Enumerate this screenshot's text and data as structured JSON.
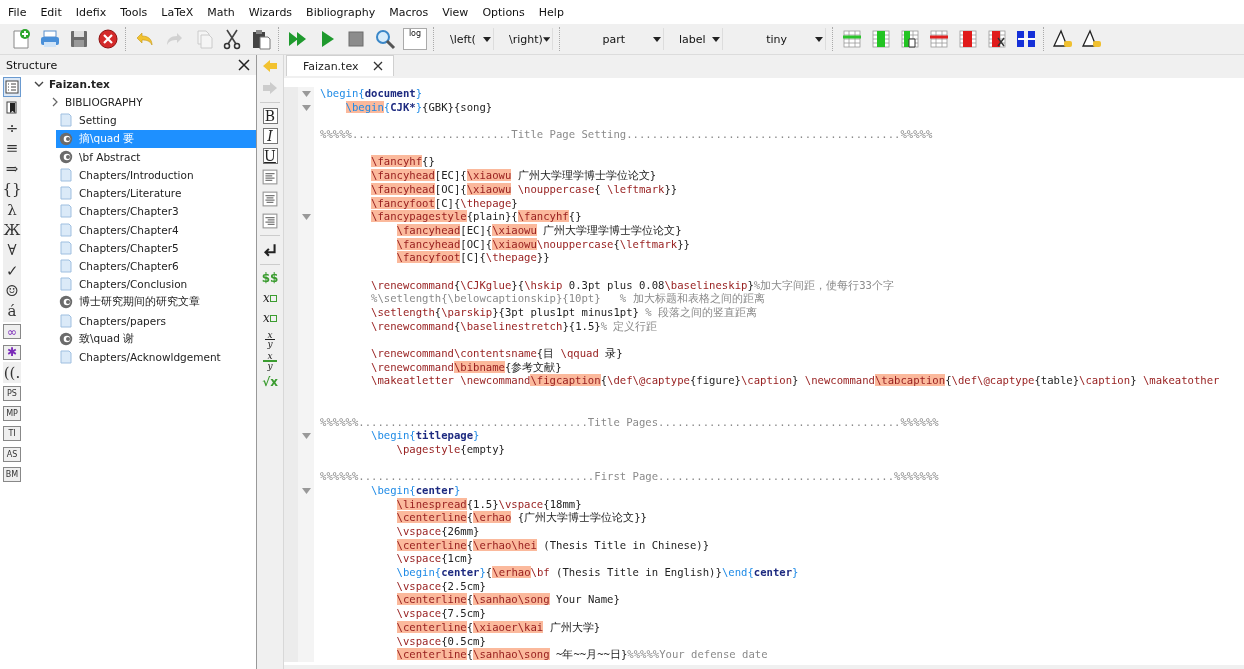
{
  "menu": [
    "File",
    "Edit",
    "Idefix",
    "Tools",
    "LaTeX",
    "Math",
    "Wizards",
    "Bibliography",
    "Macros",
    "View",
    "Options",
    "Help"
  ],
  "toolbar": [
    [
      {
        "kind": "new"
      },
      {
        "kind": "print"
      },
      {
        "kind": "save"
      },
      {
        "kind": "close"
      }
    ],
    [
      {
        "kind": "undo",
        "disabled": false
      },
      {
        "kind": "redo",
        "disabled": true
      },
      {
        "kind": "copy",
        "disabled": true
      },
      {
        "kind": "cut",
        "disabled": false
      },
      {
        "kind": "paste",
        "disabled": false
      }
    ],
    [
      {
        "kind": "build"
      },
      {
        "kind": "run"
      },
      {
        "kind": "stop"
      },
      {
        "kind": "view"
      },
      {
        "kind": "log",
        "text": "log"
      }
    ],
    [
      {
        "kind": "dropdown",
        "value": "\\left("
      },
      {
        "kind": "dropdown",
        "value": "\\right)"
      }
    ],
    [
      {
        "kind": "dropdown-wide",
        "value": "part"
      },
      {
        "kind": "dropdown",
        "value": "label"
      },
      {
        "kind": "dropdown-wide",
        "value": "tiny"
      }
    ],
    [
      {
        "kind": "t-row-add"
      },
      {
        "kind": "t-col-add"
      },
      {
        "kind": "t-col-page"
      },
      {
        "kind": "t-row-del"
      },
      {
        "kind": "t-col-del"
      },
      {
        "kind": "t-col-cut"
      },
      {
        "kind": "t-cols"
      }
    ],
    [
      {
        "kind": "triangle"
      },
      {
        "kind": "triangle"
      }
    ]
  ],
  "structure": {
    "title": "Structure",
    "tabs": [
      {
        "kind": "list",
        "selected": true
      },
      {
        "kind": "bookmark",
        "selected": false
      },
      {
        "kind": "glyph",
        "text": "÷",
        "selected": false
      },
      {
        "kind": "glyph",
        "text": "≡",
        "selected": false
      },
      {
        "kind": "glyph",
        "text": "⇒",
        "selected": false
      },
      {
        "kind": "glyph",
        "text": "{}",
        "selected": false
      },
      {
        "kind": "glyph",
        "text": "λ",
        "selected": false
      },
      {
        "kind": "glyph",
        "text": "Ж",
        "selected": false
      },
      {
        "kind": "glyph",
        "text": "∀",
        "selected": false
      },
      {
        "kind": "glyph",
        "text": "✓",
        "selected": false
      },
      {
        "kind": "glyph",
        "text": "☺",
        "selected": false
      },
      {
        "kind": "glyph",
        "text": "á",
        "selected": false
      },
      {
        "kind": "boxed",
        "text": "∞",
        "selected": false
      },
      {
        "kind": "boxed",
        "text": "✱",
        "selected": false
      },
      {
        "kind": "glyph",
        "text": "((.",
        "selected": false
      },
      {
        "kind": "boxed",
        "text": "PS",
        "selected": false
      },
      {
        "kind": "boxed",
        "text": "MP",
        "selected": false
      },
      {
        "kind": "boxed",
        "text": "TI",
        "selected": false
      },
      {
        "kind": "boxed",
        "text": "AS",
        "selected": false
      },
      {
        "kind": "boxed",
        "text": "BM",
        "selected": false
      }
    ],
    "tree": {
      "label": "Faizan.tex",
      "expanded": true,
      "children": [
        {
          "kind": "group",
          "label": "BIBLIOGRAPHY",
          "expanded": false,
          "selected": false
        },
        {
          "kind": "file",
          "label": "Setting",
          "selected": false
        },
        {
          "kind": "section",
          "label": "摘\\quad 要",
          "selected": true
        },
        {
          "kind": "section",
          "label": "\\bf Abstract",
          "selected": false
        },
        {
          "kind": "file",
          "label": "Chapters/Introduction",
          "selected": false
        },
        {
          "kind": "file",
          "label": "Chapters/Literature",
          "selected": false
        },
        {
          "kind": "file",
          "label": "Chapters/Chapter3",
          "selected": false
        },
        {
          "kind": "file",
          "label": "Chapters/Chapter4",
          "selected": false
        },
        {
          "kind": "file",
          "label": "Chapters/Chapter5",
          "selected": false
        },
        {
          "kind": "file",
          "label": "Chapters/Chapter6",
          "selected": false
        },
        {
          "kind": "file",
          "label": "Chapters/Conclusion",
          "selected": false
        },
        {
          "kind": "section",
          "label": "博士研究期间的研究文章",
          "selected": false
        },
        {
          "kind": "file",
          "label": "Chapters/papers",
          "selected": false
        },
        {
          "kind": "section",
          "label": "致\\quad 谢",
          "selected": false
        },
        {
          "kind": "file",
          "label": "Chapters/Acknowldgement",
          "selected": false
        }
      ]
    }
  },
  "navigation": [
    {
      "kind": "back",
      "disabled": false
    },
    {
      "kind": "forward",
      "disabled": true
    }
  ],
  "format_tools": [
    {
      "kind": "box",
      "text": "B"
    },
    {
      "kind": "box-italic",
      "text": "I"
    },
    {
      "kind": "box-underline",
      "text": "U"
    },
    {
      "kind": "align-left"
    },
    {
      "kind": "align-center"
    },
    {
      "kind": "align-right"
    },
    {
      "kind": "separator"
    },
    {
      "kind": "newline"
    },
    {
      "kind": "separator"
    },
    {
      "kind": "math",
      "text": "$$"
    },
    {
      "kind": "sub",
      "text": "x"
    },
    {
      "kind": "sup",
      "text": "x"
    },
    {
      "kind": "frac",
      "num": "x",
      "den": "y"
    },
    {
      "kind": "frac-strike",
      "num": "x",
      "den": "y"
    },
    {
      "kind": "math",
      "text": "√x"
    }
  ],
  "tabs": [
    {
      "label": "Faizan.tex",
      "selected": true
    }
  ],
  "editor": {
    "lines": [
      {
        "kind": "flush",
        "fold": true,
        "segs": [
          {
            "kind": "env",
            "text": "\\begin{"
          },
          {
            "kind": "arg",
            "text": "document"
          },
          {
            "kind": "env",
            "text": "}"
          }
        ]
      },
      {
        "kind": "shallow",
        "fold": true,
        "segs": [
          {
            "kind": "envhl",
            "text": "\\begin"
          },
          {
            "kind": "env",
            "text": "{"
          },
          {
            "kind": "arg",
            "text": "CJK*"
          },
          {
            "kind": "env",
            "text": "}"
          },
          {
            "kind": "text",
            "text": "{GBK}{song}"
          }
        ]
      },
      {
        "kind": "blank",
        "fold": false
      },
      {
        "kind": "flush",
        "fold": false,
        "segs": [
          {
            "kind": "comment",
            "text": "%%%%%.........................Title Page Setting...........................................%%%%%"
          }
        ]
      },
      {
        "kind": "blank",
        "fold": false
      },
      {
        "kind": "inner",
        "fold": false,
        "segs": [
          {
            "kind": "hl",
            "text": "\\fancyhf"
          },
          {
            "kind": "text",
            "text": "{}"
          }
        ]
      },
      {
        "kind": "inner",
        "fold": false,
        "segs": [
          {
            "kind": "hl",
            "text": "\\fancyhead"
          },
          {
            "kind": "text",
            "text": "[EC]{"
          },
          {
            "kind": "hl",
            "text": "\\xiaowu"
          },
          {
            "kind": "text",
            "text": " 广州大学理学博士学位论文}"
          }
        ]
      },
      {
        "kind": "inner",
        "fold": false,
        "segs": [
          {
            "kind": "hl",
            "text": "\\fancyhead"
          },
          {
            "kind": "text",
            "text": "[OC]{"
          },
          {
            "kind": "hl",
            "text": "\\xiaowu"
          },
          {
            "kind": "cmd",
            "text": " \\nouppercase"
          },
          {
            "kind": "text",
            "text": "{ "
          },
          {
            "kind": "cmd",
            "text": "\\leftmark"
          },
          {
            "kind": "text",
            "text": "}}"
          }
        ]
      },
      {
        "kind": "inner",
        "fold": false,
        "segs": [
          {
            "kind": "hl",
            "text": "\\fancyfoot"
          },
          {
            "kind": "text",
            "text": "[C]{"
          },
          {
            "kind": "cmd",
            "text": "\\thepage"
          },
          {
            "kind": "text",
            "text": "}"
          }
        ]
      },
      {
        "kind": "inner",
        "fold": true,
        "segs": [
          {
            "kind": "hl",
            "text": "\\fancypagestyle"
          },
          {
            "kind": "text",
            "text": "{plain}{"
          },
          {
            "kind": "hl",
            "text": "\\fancyhf"
          },
          {
            "kind": "text",
            "text": "{}"
          }
        ]
      },
      {
        "kind": "deep",
        "fold": false,
        "segs": [
          {
            "kind": "hl",
            "text": "\\fancyhead"
          },
          {
            "kind": "text",
            "text": "[EC]{"
          },
          {
            "kind": "hl",
            "text": "\\xiaowu"
          },
          {
            "kind": "text",
            "text": " 广州大学理学博士学位论文}"
          }
        ]
      },
      {
        "kind": "deep",
        "fold": false,
        "segs": [
          {
            "kind": "hl",
            "text": "\\fancyhead"
          },
          {
            "kind": "text",
            "text": "[OC]{"
          },
          {
            "kind": "hl",
            "text": "\\xiaowu"
          },
          {
            "kind": "cmd",
            "text": "\\nouppercase"
          },
          {
            "kind": "text",
            "text": "{"
          },
          {
            "kind": "cmd",
            "text": "\\leftmark"
          },
          {
            "kind": "text",
            "text": "}}"
          }
        ]
      },
      {
        "kind": "deep",
        "fold": false,
        "segs": [
          {
            "kind": "hl",
            "text": "\\fancyfoot"
          },
          {
            "kind": "text",
            "text": "[C]{"
          },
          {
            "kind": "cmd",
            "text": "\\thepage"
          },
          {
            "kind": "text",
            "text": "}}"
          }
        ]
      },
      {
        "kind": "blank",
        "fold": false
      },
      {
        "kind": "inner",
        "fold": false,
        "segs": [
          {
            "kind": "cmd",
            "text": "\\renewcommand"
          },
          {
            "kind": "text",
            "text": "{"
          },
          {
            "kind": "cmd",
            "text": "\\CJKglue"
          },
          {
            "kind": "text",
            "text": "}{"
          },
          {
            "kind": "cmd",
            "text": "\\hskip"
          },
          {
            "kind": "text",
            "text": " 0.3pt plus 0.08"
          },
          {
            "kind": "cmd",
            "text": "\\baselineskip"
          },
          {
            "kind": "text",
            "text": "}"
          },
          {
            "kind": "comment",
            "text": "%加大字间距，使每行33个字"
          }
        ]
      },
      {
        "kind": "inner",
        "fold": false,
        "segs": [
          {
            "kind": "comment",
            "text": "%\\setlength{\\belowcaptionskip}{10pt}   % 加大标题和表格之间的距离"
          }
        ]
      },
      {
        "kind": "inner",
        "fold": false,
        "segs": [
          {
            "kind": "cmd",
            "text": "\\setlength"
          },
          {
            "kind": "text",
            "text": "{"
          },
          {
            "kind": "cmd",
            "text": "\\parskip"
          },
          {
            "kind": "text",
            "text": "}{3pt plus1pt minus1pt} "
          },
          {
            "kind": "comment",
            "text": "% 段落之间的竖直距离"
          }
        ]
      },
      {
        "kind": "inner",
        "fold": false,
        "segs": [
          {
            "kind": "cmd",
            "text": "\\renewcommand"
          },
          {
            "kind": "text",
            "text": "{"
          },
          {
            "kind": "cmd",
            "text": "\\baselinestretch"
          },
          {
            "kind": "text",
            "text": "}{1.5}"
          },
          {
            "kind": "comment",
            "text": "% 定义行距"
          }
        ]
      },
      {
        "kind": "blank",
        "fold": false
      },
      {
        "kind": "inner",
        "fold": false,
        "segs": [
          {
            "kind": "cmd",
            "text": "\\renewcommand\\contentsname"
          },
          {
            "kind": "text",
            "text": "{目 "
          },
          {
            "kind": "cmd",
            "text": "\\qquad"
          },
          {
            "kind": "text",
            "text": " 录}"
          }
        ]
      },
      {
        "kind": "inner",
        "fold": false,
        "segs": [
          {
            "kind": "cmd",
            "text": "\\renewcommand"
          },
          {
            "kind": "hl",
            "text": "\\bibname"
          },
          {
            "kind": "text",
            "text": "{参考文献}"
          }
        ]
      },
      {
        "kind": "inner",
        "fold": false,
        "segs": [
          {
            "kind": "cmd",
            "text": "\\makeatletter \\newcommand"
          },
          {
            "kind": "hl",
            "text": "\\figcaption"
          },
          {
            "kind": "text",
            "text": "{"
          },
          {
            "kind": "cmd",
            "text": "\\def\\@captype"
          },
          {
            "kind": "text",
            "text": "{figure}"
          },
          {
            "kind": "cmd",
            "text": "\\caption"
          },
          {
            "kind": "text",
            "text": "} "
          },
          {
            "kind": "cmd",
            "text": "\\newcommand"
          },
          {
            "kind": "hl",
            "text": "\\tabcaption"
          },
          {
            "kind": "text",
            "text": "{"
          },
          {
            "kind": "cmd",
            "text": "\\def\\@captype"
          },
          {
            "kind": "text",
            "text": "{table}"
          },
          {
            "kind": "cmd",
            "text": "\\caption"
          },
          {
            "kind": "text",
            "text": "} "
          },
          {
            "kind": "cmd",
            "text": "\\makeatother"
          }
        ]
      },
      {
        "kind": "blank",
        "fold": false
      },
      {
        "kind": "blank",
        "fold": false
      },
      {
        "kind": "flush",
        "fold": false,
        "segs": [
          {
            "kind": "comment",
            "text": "%%%%%%....................................Title Pages......................................%%%%%%"
          }
        ]
      },
      {
        "kind": "inner",
        "fold": true,
        "segs": [
          {
            "kind": "env",
            "text": "\\begin{"
          },
          {
            "kind": "arg",
            "text": "titlepage"
          },
          {
            "kind": "env",
            "text": "}"
          }
        ]
      },
      {
        "kind": "deep",
        "fold": false,
        "segs": [
          {
            "kind": "cmd",
            "text": "\\pagestyle"
          },
          {
            "kind": "text",
            "text": "{empty}"
          }
        ]
      },
      {
        "kind": "blank",
        "fold": false
      },
      {
        "kind": "flush",
        "fold": false,
        "segs": [
          {
            "kind": "comment",
            "text": "%%%%%%.....................................First Page.....................................%%%%%%%"
          }
        ]
      },
      {
        "kind": "inner",
        "fold": true,
        "segs": [
          {
            "kind": "env",
            "text": "\\begin{"
          },
          {
            "kind": "arg",
            "text": "center"
          },
          {
            "kind": "env",
            "text": "}"
          }
        ]
      },
      {
        "kind": "deep",
        "fold": false,
        "segs": [
          {
            "kind": "hl",
            "text": "\\linespread"
          },
          {
            "kind": "text",
            "text": "{1.5}"
          },
          {
            "kind": "cmd",
            "text": "\\vspace"
          },
          {
            "kind": "text",
            "text": "{18mm}"
          }
        ]
      },
      {
        "kind": "deep",
        "fold": false,
        "segs": [
          {
            "kind": "hl",
            "text": "\\centerline"
          },
          {
            "kind": "text",
            "text": "{"
          },
          {
            "kind": "hl",
            "text": "\\erhao"
          },
          {
            "kind": "text",
            "text": " {广州大学博士学位论文}}"
          }
        ]
      },
      {
        "kind": "deep",
        "fold": false,
        "segs": [
          {
            "kind": "cmd",
            "text": "\\vspace"
          },
          {
            "kind": "text",
            "text": "{26mm}"
          }
        ]
      },
      {
        "kind": "deep",
        "fold": false,
        "segs": [
          {
            "kind": "hl",
            "text": "\\centerline"
          },
          {
            "kind": "text",
            "text": "{"
          },
          {
            "kind": "hl",
            "text": "\\erhao\\hei"
          },
          {
            "kind": "text",
            "text": " (Thesis Title in Chinese)}"
          }
        ]
      },
      {
        "kind": "deep",
        "fold": false,
        "segs": [
          {
            "kind": "cmd",
            "text": "\\vspace"
          },
          {
            "kind": "text",
            "text": "{1cm}"
          }
        ]
      },
      {
        "kind": "deep",
        "fold": false,
        "segs": [
          {
            "kind": "env",
            "text": "\\begin{"
          },
          {
            "kind": "arg",
            "text": "center"
          },
          {
            "kind": "env",
            "text": "}"
          },
          {
            "kind": "text",
            "text": "{"
          },
          {
            "kind": "hl",
            "text": "\\erhao"
          },
          {
            "kind": "cmd",
            "text": "\\bf"
          },
          {
            "kind": "text",
            "text": " (Thesis Title in English)}"
          },
          {
            "kind": "env",
            "text": "\\end{"
          },
          {
            "kind": "arg",
            "text": "center"
          },
          {
            "kind": "env",
            "text": "}"
          }
        ]
      },
      {
        "kind": "deep",
        "fold": false,
        "segs": [
          {
            "kind": "cmd",
            "text": "\\vspace"
          },
          {
            "kind": "text",
            "text": "{2.5cm}"
          }
        ]
      },
      {
        "kind": "deep",
        "fold": false,
        "segs": [
          {
            "kind": "hl",
            "text": "\\centerline"
          },
          {
            "kind": "text",
            "text": "{"
          },
          {
            "kind": "hl",
            "text": "\\sanhao\\song"
          },
          {
            "kind": "text",
            "text": " Your Name}"
          }
        ]
      },
      {
        "kind": "deep",
        "fold": false,
        "segs": [
          {
            "kind": "cmd",
            "text": "\\vspace"
          },
          {
            "kind": "text",
            "text": "{7.5cm}"
          }
        ]
      },
      {
        "kind": "deep",
        "fold": false,
        "segs": [
          {
            "kind": "hl",
            "text": "\\centerline"
          },
          {
            "kind": "text",
            "text": "{"
          },
          {
            "kind": "hl",
            "text": "\\xiaoer\\kai"
          },
          {
            "kind": "text",
            "text": " 广州大学}"
          }
        ]
      },
      {
        "kind": "deep",
        "fold": false,
        "segs": [
          {
            "kind": "cmd",
            "text": "\\vspace"
          },
          {
            "kind": "text",
            "text": "{0.5cm}"
          }
        ]
      },
      {
        "kind": "deep",
        "fold": false,
        "segs": [
          {
            "kind": "hl",
            "text": "\\centerline"
          },
          {
            "kind": "text",
            "text": "{"
          },
          {
            "kind": "hl",
            "text": "\\sanhao\\song"
          },
          {
            "kind": "text",
            "text": " ~年~~月~~日}"
          },
          {
            "kind": "comment",
            "text": "%%%%%Your defense date"
          }
        ]
      }
    ]
  }
}
